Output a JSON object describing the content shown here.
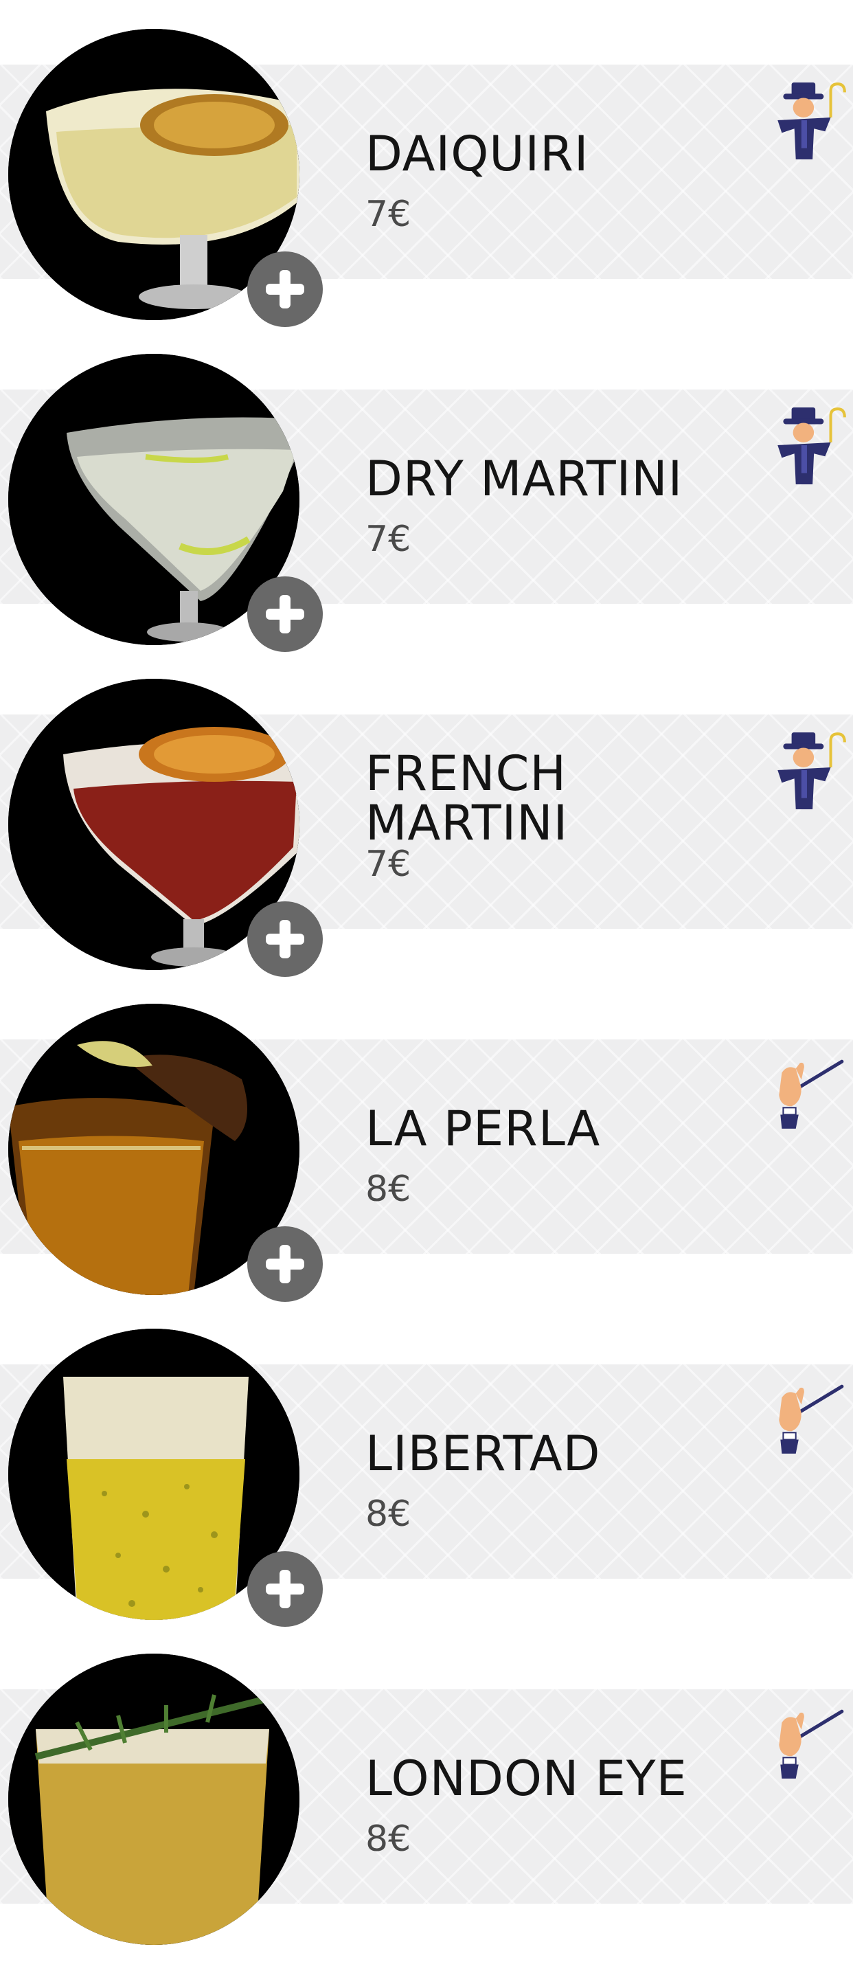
{
  "menu": {
    "items": [
      {
        "name": "DAIQUIRI",
        "price": "7€",
        "photo": "daiquiri-photo",
        "badge": "classic-gentleman-icon"
      },
      {
        "name": "DRY MARTINI",
        "price": "7€",
        "photo": "dry-martini-photo",
        "badge": "classic-gentleman-icon"
      },
      {
        "name": "FRENCH\nMARTINI",
        "price": "7€",
        "photo": "french-martini-photo",
        "badge": "classic-gentleman-icon"
      },
      {
        "name": "LA PERLA",
        "price": "8€",
        "photo": "la-perla-photo",
        "badge": "magic-wand-hand-icon"
      },
      {
        "name": "LIBERTAD",
        "price": "8€",
        "photo": "libertad-photo",
        "badge": "magic-wand-hand-icon"
      },
      {
        "name": "LONDON EYE",
        "price": "8€",
        "photo": "london-eye-photo",
        "badge": "magic-wand-hand-icon"
      }
    ]
  },
  "colors": {
    "band": "#eeeeef",
    "add_button": "#686868",
    "title": "#141414",
    "price": "#4a4a4a",
    "gentleman_suit": "#2d2f6e",
    "hand_skin": "#f2b27e"
  }
}
